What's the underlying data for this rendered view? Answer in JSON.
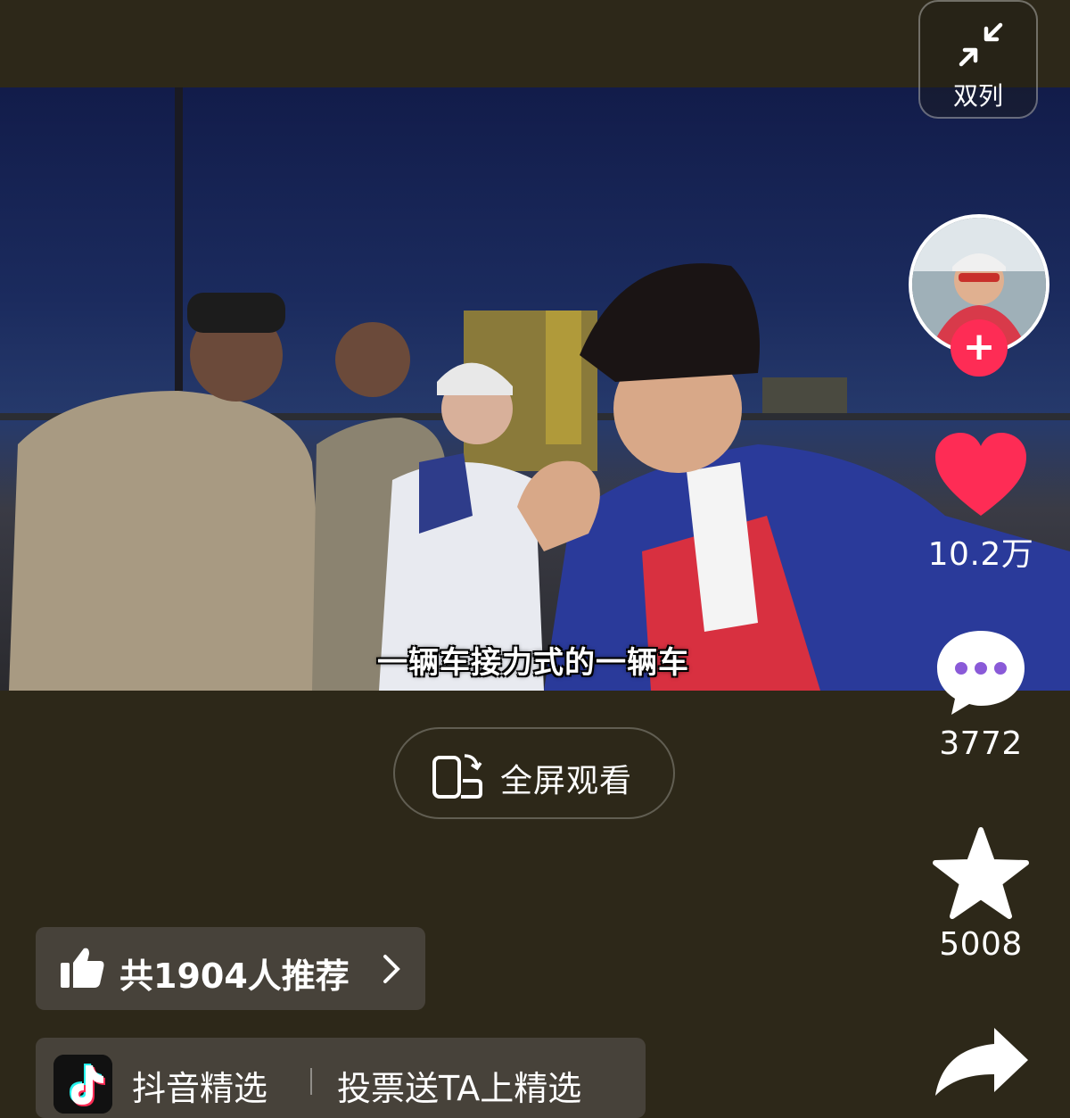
{
  "top_right": {
    "dual_column_label": "双列"
  },
  "video": {
    "subtitle": "一辆车接力式的一辆车"
  },
  "sidebar": {
    "like_count": "10.2万",
    "comment_count": "3772",
    "favorite_count": "5008"
  },
  "fullscreen": {
    "label": "全屏观看"
  },
  "recommend": {
    "label": "共1904人推荐"
  },
  "promo": {
    "left_text": "抖音精选",
    "right_text": "投票送TA上精选"
  },
  "colors": {
    "accent_red": "#fe2c55",
    "background": "#2d2819",
    "chip_bg": "#47423a"
  }
}
